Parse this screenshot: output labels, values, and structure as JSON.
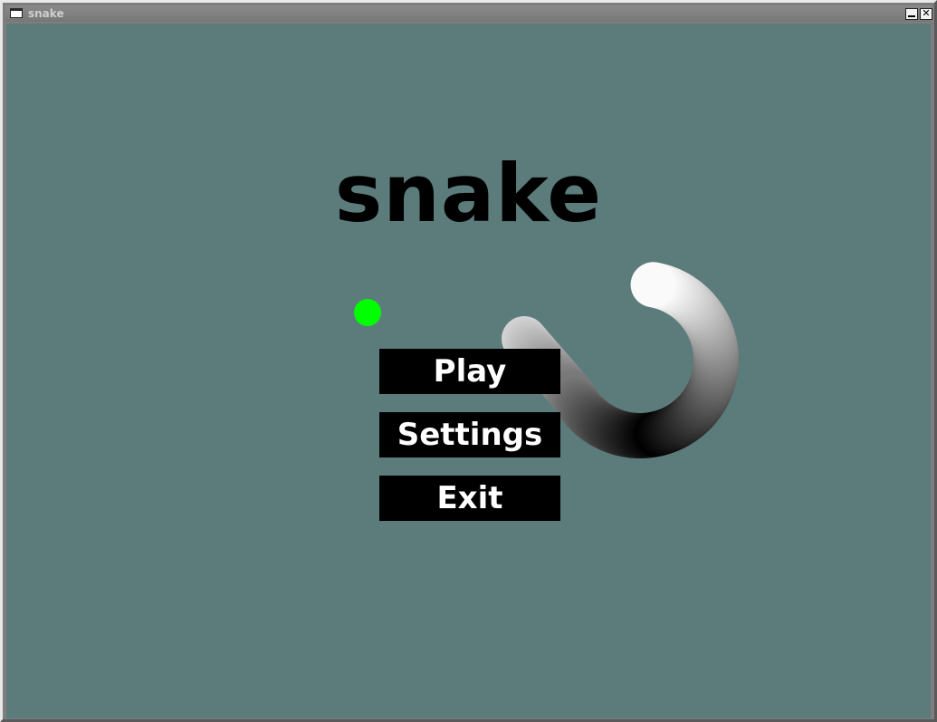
{
  "window": {
    "title": "snake",
    "minimize_glyph": "_",
    "close_glyph": "✕"
  },
  "game": {
    "title": "snake",
    "background_color": "#5c7b7b",
    "food_color": "#00ff00"
  },
  "menu": {
    "play_label": "Play",
    "settings_label": "Settings",
    "exit_label": "Exit"
  }
}
